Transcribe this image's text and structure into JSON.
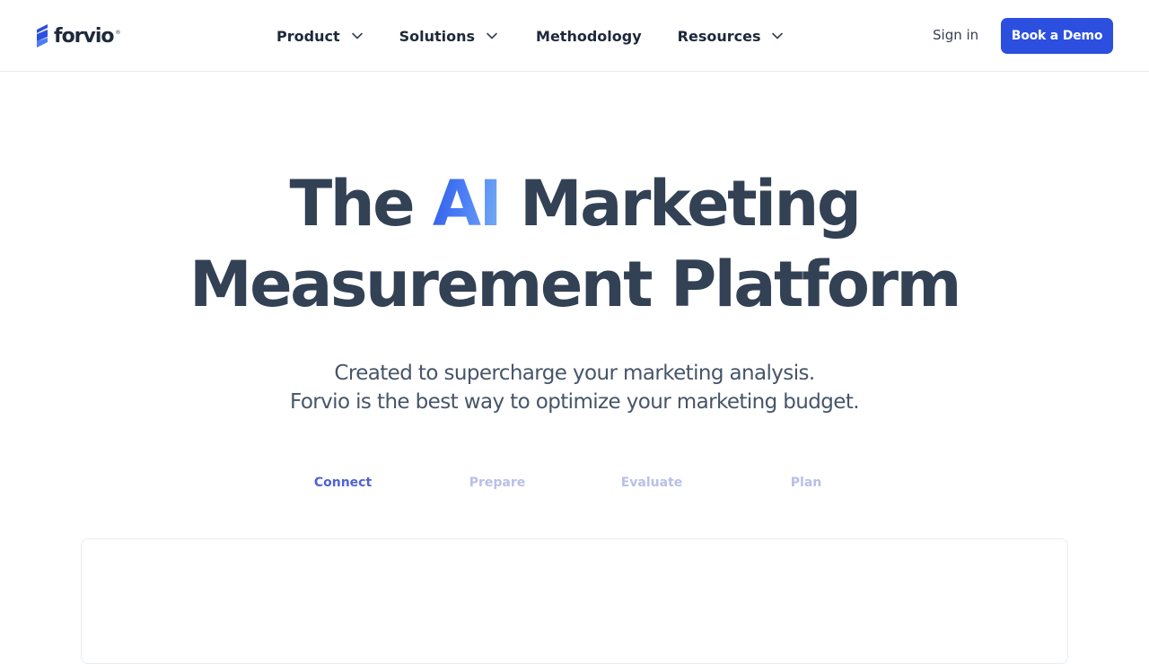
{
  "header": {
    "logo": {
      "text": "forvio",
      "mark": "®",
      "icon": "forvio-logo-icon"
    },
    "nav": [
      {
        "label": "Product",
        "has_dropdown": true
      },
      {
        "label": "Solutions",
        "has_dropdown": true
      },
      {
        "label": "Methodology",
        "has_dropdown": false
      },
      {
        "label": "Resources",
        "has_dropdown": true
      }
    ],
    "sign_in_label": "Sign in",
    "demo_button_label": "Book a Demo"
  },
  "hero": {
    "title_pre": "The ",
    "title_highlight": "AI",
    "title_post_line1": " Marketing",
    "title_line2": "Measurement Platform",
    "subtitle_line1": "Created to supercharge your marketing analysis.",
    "subtitle_line2": "Forvio is the best way to optimize your marketing budget."
  },
  "steps": {
    "items": [
      "Connect",
      "Prepare",
      "Evaluate",
      "Plan"
    ],
    "active": "Connect"
  },
  "colors": {
    "brand": "#2c4fe0",
    "heading": "#334155",
    "step_active": "#4f63d2",
    "step_inactive": "#b8c0e8",
    "ai_gradient": [
      "#2f5be6",
      "#78aef2"
    ]
  }
}
